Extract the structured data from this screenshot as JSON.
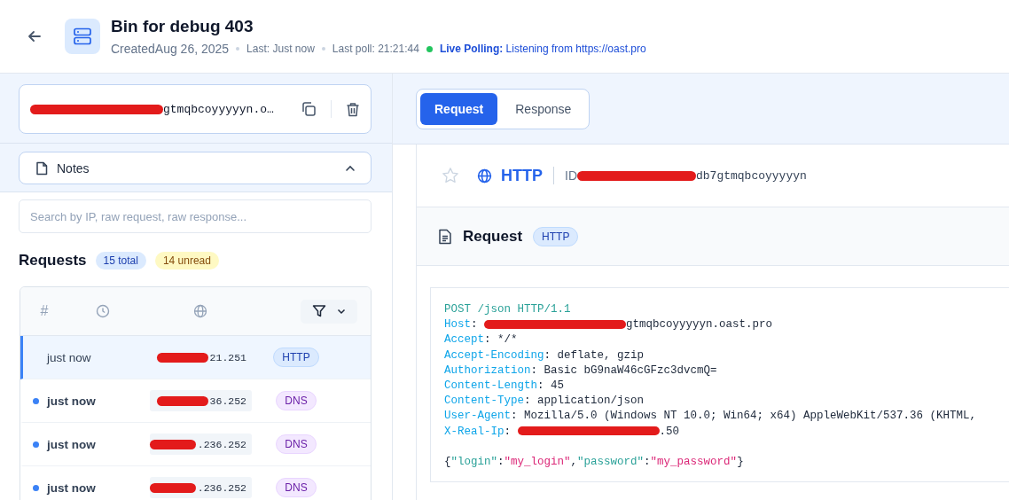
{
  "header": {
    "title": "Bin for debug 403",
    "created": "CreatedAug 26, 2025",
    "last": "Last: Just now",
    "last_poll": "Last poll: 21:21:44",
    "live": {
      "on": true,
      "label": "Live Polling:",
      "text": "Listening from https://oast.pro"
    }
  },
  "address": {
    "redacted": true,
    "text": "gtmqbcoyyyyyn.o…"
  },
  "notes": {
    "label": "Notes",
    "expanded": true
  },
  "search": {
    "placeholder": "Search by IP, raw request, raw response..."
  },
  "requests": {
    "title": "Requests",
    "total": "15 total",
    "unread": "14 unread",
    "columns": [
      {
        "kind": "hash",
        "text": "#"
      },
      {
        "kind": "time"
      },
      {
        "kind": "ip"
      },
      {
        "kind": "filter"
      }
    ],
    "rows": [
      {
        "selected": true,
        "unread": false,
        "time": "just now",
        "ip_redacted": true,
        "ip": "21.251",
        "type": "HTTP"
      },
      {
        "selected": false,
        "unread": true,
        "time": "just now",
        "ip_redacted": true,
        "ip": "36.252",
        "type": "DNS"
      },
      {
        "selected": false,
        "unread": true,
        "time": "just now",
        "ip_redacted": true,
        "ip": ".236.252",
        "type": "DNS"
      },
      {
        "selected": false,
        "unread": true,
        "time": "just now",
        "ip_redacted": true,
        "ip": ".236.252",
        "type": "DNS"
      }
    ]
  },
  "tabs": [
    {
      "label": "Request",
      "selected": true
    },
    {
      "label": "Response",
      "selected": false
    }
  ],
  "detail": {
    "starred": false,
    "protocol": "HTTP",
    "id_label": "ID",
    "id_redacted": true,
    "id": "db7gtmqbcoyyyyyn",
    "section_title": "Request",
    "section_badge": "HTTP",
    "lines": [
      {
        "kind": "request_line",
        "text": "POST /json HTTP/1.1"
      },
      {
        "kind": "header",
        "name": "Host",
        "separator": ":",
        "redacted": true,
        "value": "gtmqbcoyyyyyn.oast.pro"
      },
      {
        "kind": "header",
        "name": "Accept",
        "separator": ":",
        "redacted": false,
        "value": "*/*"
      },
      {
        "kind": "header",
        "name": "Accept-Encoding",
        "separator": ":",
        "redacted": false,
        "value": "deflate, gzip"
      },
      {
        "kind": "header",
        "name": "Authorization",
        "separator": ":",
        "redacted": false,
        "value": "Basic bG9naW46cGFzc3dvcmQ="
      },
      {
        "kind": "header",
        "name": "Content-Length",
        "separator": ":",
        "redacted": false,
        "value": "45"
      },
      {
        "kind": "header",
        "name": "Content-Type",
        "separator": ":",
        "redacted": false,
        "value": "application/json"
      },
      {
        "kind": "header",
        "name": "User-Agent",
        "separator": ":",
        "redacted": false,
        "value": "Mozilla/5.0 (Windows NT 10.0; Win64; x64) AppleWebKit/537.36 (KHTML,"
      },
      {
        "kind": "header",
        "name": "X-Real-Ip",
        "separator": ":",
        "redacted": true,
        "value": ".50"
      },
      {
        "kind": "blank"
      },
      {
        "kind": "body",
        "tokens": [
          {
            "kind": "punct",
            "text": "{"
          },
          {
            "kind": "key",
            "text": "\"login\""
          },
          {
            "kind": "punct",
            "text": ":"
          },
          {
            "kind": "string",
            "text": "\"my_login\""
          },
          {
            "kind": "punct",
            "text": ","
          },
          {
            "kind": "key",
            "text": "\"password\""
          },
          {
            "kind": "punct",
            "text": ":"
          },
          {
            "kind": "string",
            "text": "\"my_password\""
          },
          {
            "kind": "punct",
            "text": "}"
          }
        ]
      }
    ]
  }
}
